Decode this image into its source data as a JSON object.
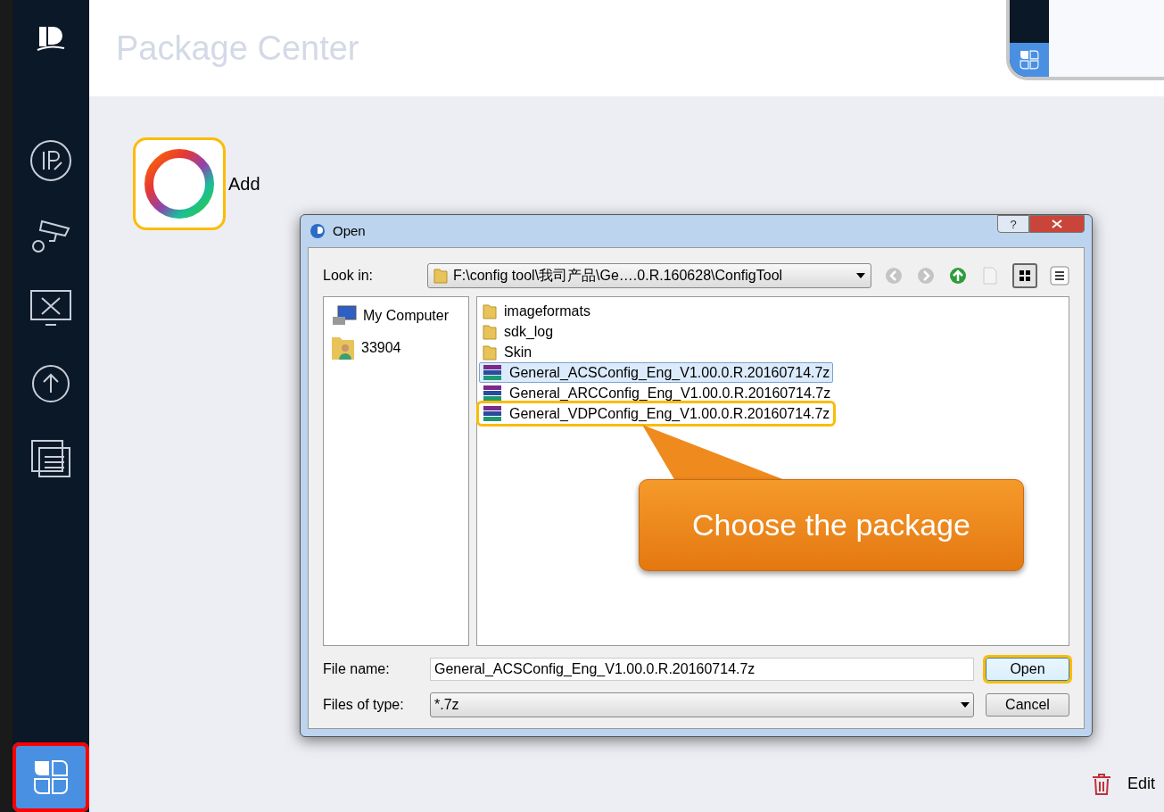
{
  "app": {
    "title": "Package Center"
  },
  "sidebar": {
    "items": [
      {
        "kind": "ip",
        "selected": false,
        "highlighted": false
      },
      {
        "kind": "camera",
        "selected": false,
        "highlighted": false
      },
      {
        "kind": "tools",
        "selected": false,
        "highlighted": false
      },
      {
        "kind": "upgrade",
        "selected": false,
        "highlighted": false
      },
      {
        "kind": "documents",
        "selected": false,
        "highlighted": false
      },
      {
        "kind": "packages",
        "selected": true,
        "highlighted": true
      }
    ]
  },
  "add": {
    "label": "Add",
    "highlighted": true
  },
  "dialog": {
    "title": "Open",
    "help": "?",
    "look_in": {
      "label": "Look in:",
      "value": "F:\\config tool\\我司产品\\Ge….0.R.160628\\ConfigTool"
    },
    "places": [
      {
        "kind": "computer",
        "label": "My Computer"
      },
      {
        "kind": "user",
        "label": "33904"
      }
    ],
    "files": [
      {
        "kind": "folder",
        "name": "imageformats",
        "selected": false,
        "highlighted": false
      },
      {
        "kind": "folder",
        "name": "sdk_log",
        "selected": false,
        "highlighted": false
      },
      {
        "kind": "folder",
        "name": "Skin",
        "selected": false,
        "highlighted": false
      },
      {
        "kind": "archive",
        "name": "General_ACSConfig_Eng_V1.00.0.R.20160714.7z",
        "selected": true,
        "highlighted": false
      },
      {
        "kind": "archive",
        "name": "General_ARCConfig_Eng_V1.00.0.R.20160714.7z",
        "selected": false,
        "highlighted": false
      },
      {
        "kind": "archive",
        "name": "General_VDPConfig_Eng_V1.00.0.R.20160714.7z",
        "selected": false,
        "highlighted": true
      }
    ],
    "file_name": {
      "label": "File name:",
      "value": "General_ACSConfig_Eng_V1.00.0.R.20160714.7z"
    },
    "file_type": {
      "label": "Files of type:",
      "value": "*.7z"
    },
    "buttons": [
      {
        "label": "Open",
        "highlighted": true
      },
      {
        "label": "Cancel",
        "highlighted": false
      }
    ]
  },
  "callout": {
    "text": "Choose the package"
  },
  "edit": {
    "label": "Edit"
  }
}
